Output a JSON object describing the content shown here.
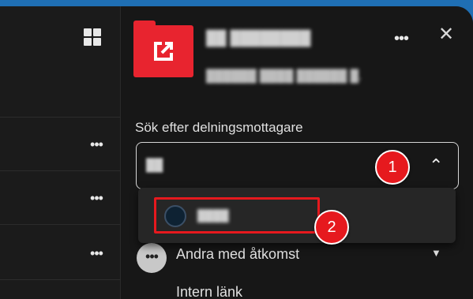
{
  "left_panel": {
    "grid_icon": "grid-icon",
    "rows": [
      {
        "more": "•••"
      },
      {
        "more": "•••"
      },
      {
        "more": "•••"
      }
    ]
  },
  "header": {
    "folder_icon": "shared-folder-icon",
    "title_redacted": "██ ████████",
    "subtitle_redacted": "██████ ████ ██████ █.",
    "more": "•••",
    "close": "✕"
  },
  "share": {
    "label": "Sök efter delningsmottagare",
    "search_value": "██",
    "chevron": "⌃",
    "result_name_redacted": "████"
  },
  "annotations": {
    "badge_1": "1",
    "badge_2": "2"
  },
  "access": {
    "icon": "•••",
    "label": "Andra med åtkomst",
    "caret": "▼"
  },
  "links": {
    "internal": "Intern länk"
  },
  "colors": {
    "accent_red": "#e8242f",
    "annotation_red": "#e6191e",
    "background": "#171717",
    "top_bar_blue": "#1f6fb4"
  }
}
